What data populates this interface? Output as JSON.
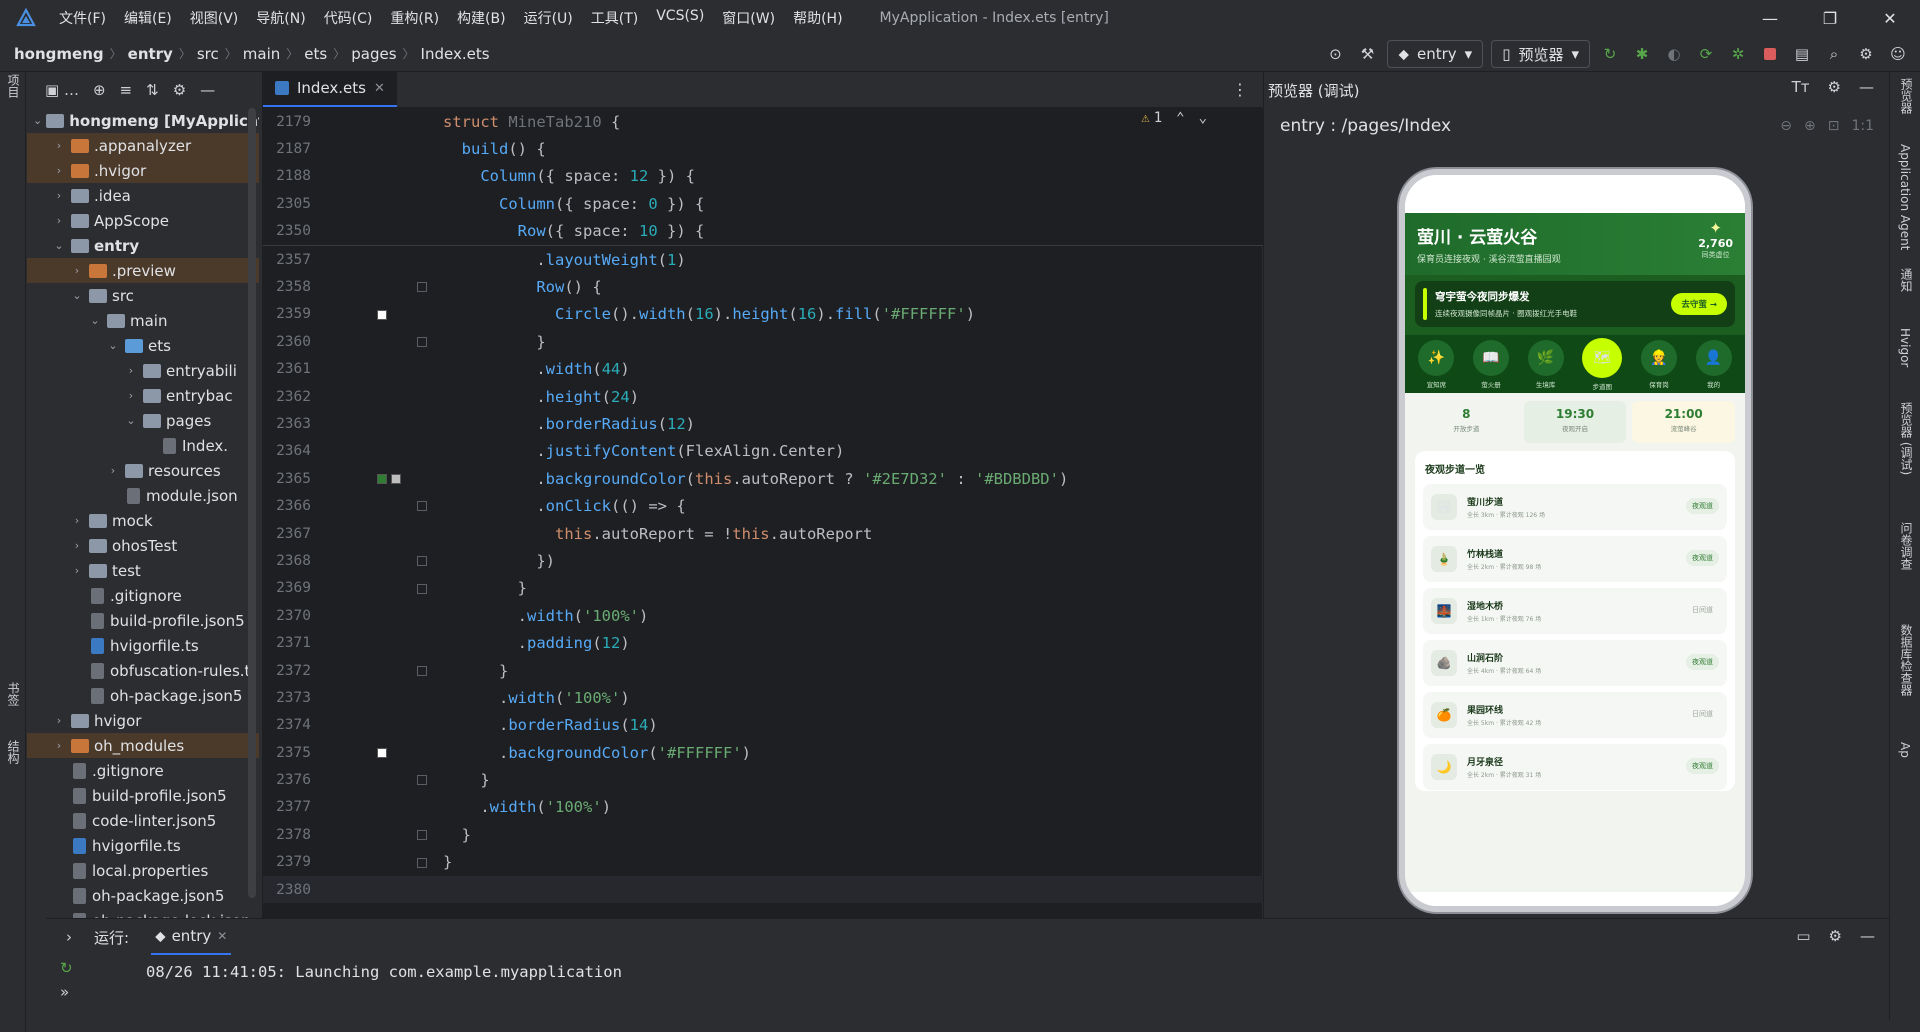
{
  "titlebar": {
    "menu": [
      "文件(F)",
      "编辑(E)",
      "视图(V)",
      "导航(N)",
      "代码(C)",
      "重构(R)",
      "构建(B)",
      "运行(U)",
      "工具(T)",
      "VCS(S)",
      "窗口(W)",
      "帮助(H)"
    ],
    "title": "MyApplication - Index.ets [entry]"
  },
  "breadcrumb": [
    "hongmeng",
    "entry",
    "src",
    "main",
    "ets",
    "pages",
    "Index.ets"
  ],
  "toolbar": {
    "run_config": "entry",
    "device": "预览器"
  },
  "left_strip": {
    "project": "项目",
    "bookmarks": "书签",
    "structure": "结构"
  },
  "project_tree": [
    {
      "indent": 0,
      "chev": "v",
      "icon": "folder",
      "label": "hongmeng [MyApplicati",
      "bold": true
    },
    {
      "indent": 1,
      "chev": ">",
      "icon": "folder o",
      "label": ".appanalyzer",
      "hl": true
    },
    {
      "indent": 1,
      "chev": ">",
      "icon": "folder o",
      "label": ".hvigor",
      "hl": true
    },
    {
      "indent": 1,
      "chev": ">",
      "icon": "folder",
      "label": ".idea"
    },
    {
      "indent": 1,
      "chev": ">",
      "icon": "folder",
      "label": "AppScope"
    },
    {
      "indent": 1,
      "chev": "v",
      "icon": "folder",
      "label": "entry",
      "bold": true
    },
    {
      "indent": 2,
      "chev": ">",
      "icon": "folder o",
      "label": ".preview",
      "hl": true
    },
    {
      "indent": 2,
      "chev": "v",
      "icon": "folder",
      "label": "src"
    },
    {
      "indent": 3,
      "chev": "v",
      "icon": "folder",
      "label": "main"
    },
    {
      "indent": 4,
      "chev": "v",
      "icon": "folder b",
      "label": "ets"
    },
    {
      "indent": 5,
      "chev": ">",
      "icon": "folder",
      "label": "entryabili"
    },
    {
      "indent": 5,
      "chev": ">",
      "icon": "folder",
      "label": "entrybac"
    },
    {
      "indent": 5,
      "chev": "v",
      "icon": "folder",
      "label": "pages"
    },
    {
      "indent": 6,
      "chev": "",
      "icon": "file",
      "label": "Index."
    },
    {
      "indent": 4,
      "chev": ">",
      "icon": "folder",
      "label": "resources"
    },
    {
      "indent": 4,
      "chev": "",
      "icon": "file",
      "label": "module.json"
    },
    {
      "indent": 2,
      "chev": ">",
      "icon": "folder",
      "label": "mock"
    },
    {
      "indent": 2,
      "chev": ">",
      "icon": "folder",
      "label": "ohosTest"
    },
    {
      "indent": 2,
      "chev": ">",
      "icon": "folder",
      "label": "test"
    },
    {
      "indent": 2,
      "chev": "",
      "icon": "file",
      "label": ".gitignore"
    },
    {
      "indent": 2,
      "chev": "",
      "icon": "file",
      "label": "build-profile.json5"
    },
    {
      "indent": 2,
      "chev": "",
      "icon": "ts",
      "label": "hvigorfile.ts"
    },
    {
      "indent": 2,
      "chev": "",
      "icon": "file",
      "label": "obfuscation-rules.t"
    },
    {
      "indent": 2,
      "chev": "",
      "icon": "file",
      "label": "oh-package.json5"
    },
    {
      "indent": 1,
      "chev": ">",
      "icon": "folder",
      "label": "hvigor"
    },
    {
      "indent": 1,
      "chev": ">",
      "icon": "folder o",
      "label": "oh_modules",
      "hl": true
    },
    {
      "indent": 1,
      "chev": "",
      "icon": "file",
      "label": ".gitignore"
    },
    {
      "indent": 1,
      "chev": "",
      "icon": "file",
      "label": "build-profile.json5"
    },
    {
      "indent": 1,
      "chev": "",
      "icon": "file",
      "label": "code-linter.json5"
    },
    {
      "indent": 1,
      "chev": "",
      "icon": "ts",
      "label": "hvigorfile.ts"
    },
    {
      "indent": 1,
      "chev": "",
      "icon": "file",
      "label": "local.properties"
    },
    {
      "indent": 1,
      "chev": "",
      "icon": "file",
      "label": "oh-package.json5"
    },
    {
      "indent": 1,
      "chev": "",
      "icon": "file",
      "label": "oh-package-lock.json"
    }
  ],
  "editor": {
    "tab": "Index.ets",
    "warning_count": "1",
    "sticky": [
      {
        "n": "2179",
        "html": "<span class='k'>struct</span> <span class='g'>MineTab210</span> <span class='t'>{</span>"
      },
      {
        "n": "2187",
        "html": "  <span class='f'>build</span><span class='t'>() {</span>"
      },
      {
        "n": "2188",
        "html": "    <span class='f'>Column</span><span class='t'>({ space: </span><span class='n'>12</span><span class='t'> }) {</span>"
      },
      {
        "n": "2305",
        "html": "      <span class='f'>Column</span><span class='t'>({ space: </span><span class='n'>0</span><span class='t'> }) {</span>"
      },
      {
        "n": "2350",
        "html": "        <span class='f'>Row</span><span class='t'>({ space: </span><span class='n'>10</span><span class='t'> }) {</span>"
      }
    ],
    "lines": [
      {
        "n": "2357",
        "html": "          <span class='t'>.</span><span class='f'>layoutWeight</span><span class='t'>(</span><span class='n'>1</span><span class='t'>)</span>"
      },
      {
        "n": "2358",
        "html": "          <span class='f'>Row</span><span class='t'>() {</span>",
        "fold": true
      },
      {
        "n": "2359",
        "html": "            <span class='f'>Circle</span><span class='t'>().</span><span class='f'>width</span><span class='t'>(</span><span class='n'>16</span><span class='t'>).</span><span class='f'>height</span><span class='t'>(</span><span class='n'>16</span><span class='t'>).</span><span class='f'>fill</span><span class='t'>(</span><span class='s'>'#FFFFFF'</span><span class='t'>)</span>",
        "swatch": [
          "#ffffff"
        ]
      },
      {
        "n": "2360",
        "html": "          <span class='t'>}</span>",
        "fold": true
      },
      {
        "n": "2361",
        "html": "          <span class='t'>.</span><span class='f'>width</span><span class='t'>(</span><span class='n'>44</span><span class='t'>)</span>"
      },
      {
        "n": "2362",
        "html": "          <span class='t'>.</span><span class='f'>height</span><span class='t'>(</span><span class='n'>24</span><span class='t'>)</span>"
      },
      {
        "n": "2363",
        "html": "          <span class='t'>.</span><span class='f'>borderRadius</span><span class='t'>(</span><span class='n'>12</span><span class='t'>)</span>"
      },
      {
        "n": "2364",
        "html": "          <span class='t'>.</span><span class='f'>justifyContent</span><span class='t'>(FlexAlign.Center)</span>"
      },
      {
        "n": "2365",
        "html": "          <span class='t'>.</span><span class='f'>backgroundColor</span><span class='t'>(</span><span class='k'>this</span><span class='t'>.autoReport ? </span><span class='s'>'#2E7D32'</span><span class='t'> : </span><span class='s'>'#BDBDBD'</span><span class='t'>)</span>",
        "swatch": [
          "#2e7d32",
          "#bdbdbd"
        ]
      },
      {
        "n": "2366",
        "html": "          <span class='t'>.</span><span class='f'>onClick</span><span class='t'>(() => {</span>",
        "fold": true
      },
      {
        "n": "2367",
        "html": "            <span class='k'>this</span><span class='t'>.autoReport = !</span><span class='k'>this</span><span class='t'>.autoReport</span>"
      },
      {
        "n": "2368",
        "html": "          <span class='t'>})</span>",
        "fold": true
      },
      {
        "n": "2369",
        "html": "        <span class='t'>}</span>",
        "fold": true
      },
      {
        "n": "2370",
        "html": "        <span class='t'>.</span><span class='f'>width</span><span class='t'>(</span><span class='s'>'100%'</span><span class='t'>)</span>"
      },
      {
        "n": "2371",
        "html": "        <span class='t'>.</span><span class='f'>padding</span><span class='t'>(</span><span class='n'>12</span><span class='t'>)</span>"
      },
      {
        "n": "2372",
        "html": "      <span class='t'>}</span>",
        "fold": true
      },
      {
        "n": "2373",
        "html": "      <span class='t'>.</span><span class='f'>width</span><span class='t'>(</span><span class='s'>'100%'</span><span class='t'>)</span>"
      },
      {
        "n": "2374",
        "html": "      <span class='t'>.</span><span class='f'>borderRadius</span><span class='t'>(</span><span class='n'>14</span><span class='t'>)</span>"
      },
      {
        "n": "2375",
        "html": "      <span class='t'>.</span><span class='f'>backgroundColor</span><span class='t'>(</span><span class='s'>'#FFFFFF'</span><span class='t'>)</span>",
        "swatch": [
          "#ffffff"
        ]
      },
      {
        "n": "2376",
        "html": "    <span class='t'>}</span>",
        "fold": true
      },
      {
        "n": "2377",
        "html": "    <span class='t'>.</span><span class='f'>width</span><span class='t'>(</span><span class='s'>'100%'</span><span class='t'>)</span>"
      },
      {
        "n": "2378",
        "html": "  <span class='t'>}</span>",
        "fold": true
      },
      {
        "n": "2379",
        "html": "<span class='t'>}</span>",
        "fold": true
      },
      {
        "n": "2380",
        "html": "",
        "current": true
      }
    ]
  },
  "preview": {
    "panel_title": "预览器 (调试)",
    "route": "entry : /pages/Index",
    "app": {
      "title": "萤川 · 云萤火谷",
      "subtitle": "保育员连接夜观 · 溪谷流萤直播园观",
      "stat_value": "2,760",
      "stat_label": "同类虚位",
      "banner_title": "穹宇萤今夜同步爆发",
      "banner_sub": "连续夜观摄像同帧晶片 · 圈观拨红光手电鞋",
      "banner_btn": "去守萤 →",
      "shortcuts": [
        {
          "icon": "✨",
          "label": "宣知席"
        },
        {
          "icon": "📖",
          "label": "萤火册"
        },
        {
          "icon": "🌿",
          "label": "生境库"
        },
        {
          "icon": "🗺",
          "label": "步道图",
          "active": true
        },
        {
          "icon": "👷",
          "label": "保育岗"
        },
        {
          "icon": "👤",
          "label": "我的"
        }
      ],
      "times": [
        {
          "value": "8",
          "label": "开放步道",
          "bg": "#f1f4ef"
        },
        {
          "value": "19:30",
          "label": "夜观开启",
          "bg": "#e6efe4"
        },
        {
          "value": "21:00",
          "label": "流萤峰谷",
          "bg": "#fbf7e3"
        }
      ],
      "list_title": "夜观步道一览",
      "routes": [
        {
          "icon": "🏞",
          "name": "萤川步道",
          "sub": "全长 3km · 累计夜观 126 场",
          "badge": "夜观道",
          "off": false
        },
        {
          "icon": "🎍",
          "name": "竹林栈道",
          "sub": "全长 2km · 累计夜观 98 场",
          "badge": "夜观道",
          "off": false
        },
        {
          "icon": "🌉",
          "name": "湿地木桥",
          "sub": "全长 1km · 累计夜观 76 场",
          "badge": "日间道",
          "off": true
        },
        {
          "icon": "🪨",
          "name": "山涧石阶",
          "sub": "全长 4km · 累计夜观 64 场",
          "badge": "夜观道",
          "off": false
        },
        {
          "icon": "🍊",
          "name": "果园环线",
          "sub": "全长 5km · 累计夜观 42 场",
          "badge": "日间道",
          "off": true
        },
        {
          "icon": "🌙",
          "name": "月牙泉径",
          "sub": "全长 2km · 累计夜观 31 场",
          "badge": "夜观道",
          "off": false
        }
      ]
    }
  },
  "right_strip": [
    "预览器",
    "Application Agent",
    "通知",
    "Hvigor",
    "预览器 (调试)",
    "问卷调查",
    "数据库检查器",
    "Ap"
  ],
  "run": {
    "label": "运行:",
    "tab": "entry",
    "output": "08/26 11:41:05: Launching com.example.myapplication"
  }
}
